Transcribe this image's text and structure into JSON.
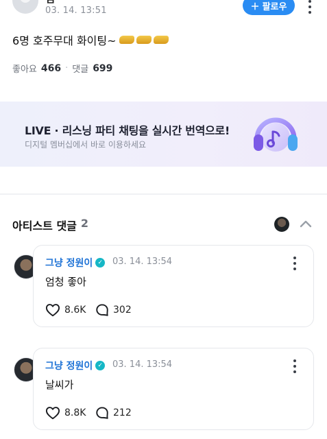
{
  "post": {
    "author": "잼",
    "time": "03. 14. 13:51",
    "follow_label": "팔로우",
    "body": "6명 호주무대 화이팅~",
    "likes_label": "좋아요",
    "likes": "466",
    "comments_label": "댓글",
    "comments": "699"
  },
  "banner": {
    "title": "LIVE · 리스닝 파티 채팅을 실시간 번역으로!",
    "subtitle": "디지털 멤버십에서 바로 이용하세요"
  },
  "artist_comments": {
    "title": "아티스트 댓글",
    "count": "2",
    "items": [
      {
        "name": "그냥 정원이",
        "time": "03. 14. 13:54",
        "text": "엄청 좋아",
        "likes": "8.6K",
        "replies": "302"
      },
      {
        "name": "그냥 정원이",
        "time": "03. 14. 13:54",
        "text": "날씨가",
        "likes": "8.8K",
        "replies": "212"
      }
    ]
  },
  "colors": {
    "accent": "#2a8cf3",
    "name_link": "#1f73d6",
    "verified": "#16b7c6",
    "banner_bg": "#eef0fb"
  }
}
